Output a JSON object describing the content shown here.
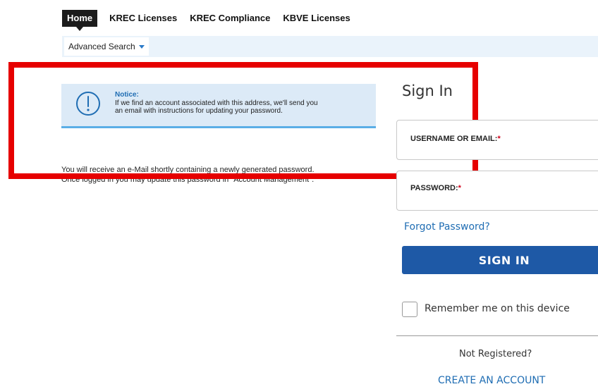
{
  "nav": {
    "items": [
      "Home",
      "KREC Licenses",
      "KREC Compliance",
      "KBVE Licenses"
    ],
    "active": "Home"
  },
  "subnav": {
    "advanced_search": "Advanced Search"
  },
  "notice": {
    "icon": "exclamation-circle-icon",
    "title": "Notice:",
    "line1": "If we find an account associated with this address, we'll send you",
    "line2": "an email with instructions for updating your password."
  },
  "message": {
    "line1": "You will receive an e-Mail shortly containing a newly generated password.",
    "line2": "Once logged in you may update this password in \"Account Management\"."
  },
  "signin": {
    "title": "Sign In",
    "username_label": "USERNAME OR EMAIL:",
    "password_label": "PASSWORD:",
    "required_mark": "*",
    "forgot": "Forgot Password?",
    "button": "SIGN IN",
    "remember": "Remember me on this device",
    "not_registered": "Not Registered?",
    "create_account": "CREATE AN ACCOUNT"
  },
  "colors": {
    "nav_active_bg": "#1c1c1c",
    "subnav_bg": "#eaf3fb",
    "notice_bg": "#dceaf7",
    "link": "#1f6db3",
    "button_bg": "#1e59a6",
    "highlight": "#e60000"
  }
}
